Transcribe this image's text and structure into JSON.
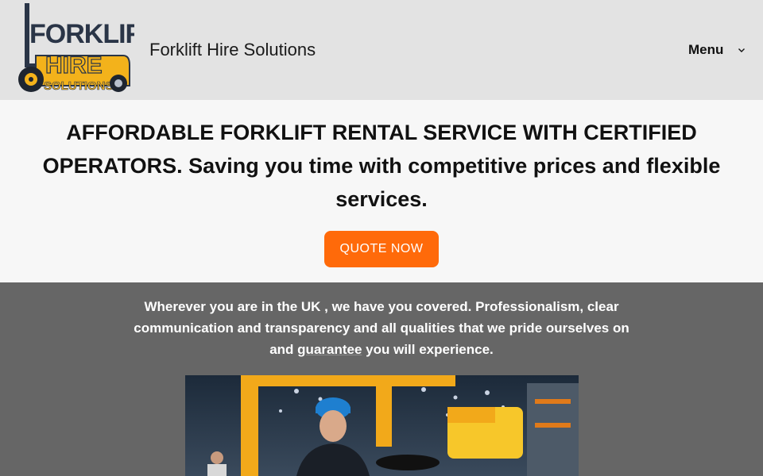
{
  "header": {
    "logo": {
      "line1": "FORKLIFT",
      "line2": "HIRE",
      "line3": "SOLUTIONS"
    },
    "site_title": "Forklift Hire Solutions",
    "menu_label": "Menu"
  },
  "hero": {
    "title_caps": "AFFORDABLE FORKLIFT RENTAL SERVICE WITH CERTIFIED OPERATORS.",
    "title_rest": " Saving you time with competitive prices and flexible services.",
    "cta_label": "QUOTE NOW"
  },
  "coverage": {
    "text_before": "Wherever you are in the UK , we have you covered. Professionalism, clear communication and transparency and all qualities that we pride ourselves on and ",
    "emphasis": "guarantee",
    "text_after": " you will experience."
  },
  "colors": {
    "header_bg": "#e3e3e3",
    "accent": "#ff6a0a",
    "dark_section_bg": "#666666",
    "logo_yellow": "#f3b21b",
    "logo_navy": "#2a3547"
  }
}
